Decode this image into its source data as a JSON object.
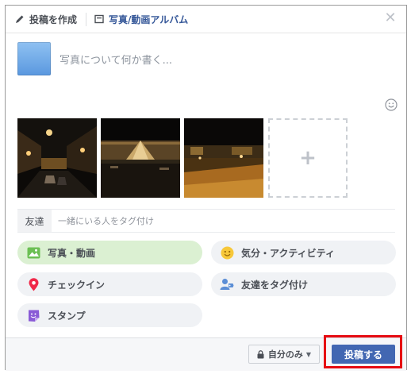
{
  "header": {
    "compose_tab": "投稿を作成",
    "album_tab": "写真/動画アルバム"
  },
  "composer": {
    "placeholder": "写真について何か書く..."
  },
  "tag": {
    "label": "友達",
    "placeholder": "一緒にいる人をタグ付け"
  },
  "actions": {
    "photo": "写真・動画",
    "feeling": "気分・アクティビティ",
    "checkin": "チェックイン",
    "tag_friends": "友達をタグ付け",
    "sticker": "スタンプ"
  },
  "footer": {
    "privacy": "自分のみ",
    "post": "投稿する"
  },
  "colors": {
    "brand": "#4267b2",
    "link": "#365899",
    "highlight": "#e60b12",
    "photo_pill": "#dbf0d2"
  },
  "icons": [
    "pencil-icon",
    "album-icon",
    "close-icon",
    "emoji-icon",
    "plus-icon",
    "photo-icon",
    "smiley-icon",
    "location-pin-icon",
    "tag-friend-icon",
    "sticker-icon",
    "lock-icon",
    "caret-down-icon"
  ]
}
